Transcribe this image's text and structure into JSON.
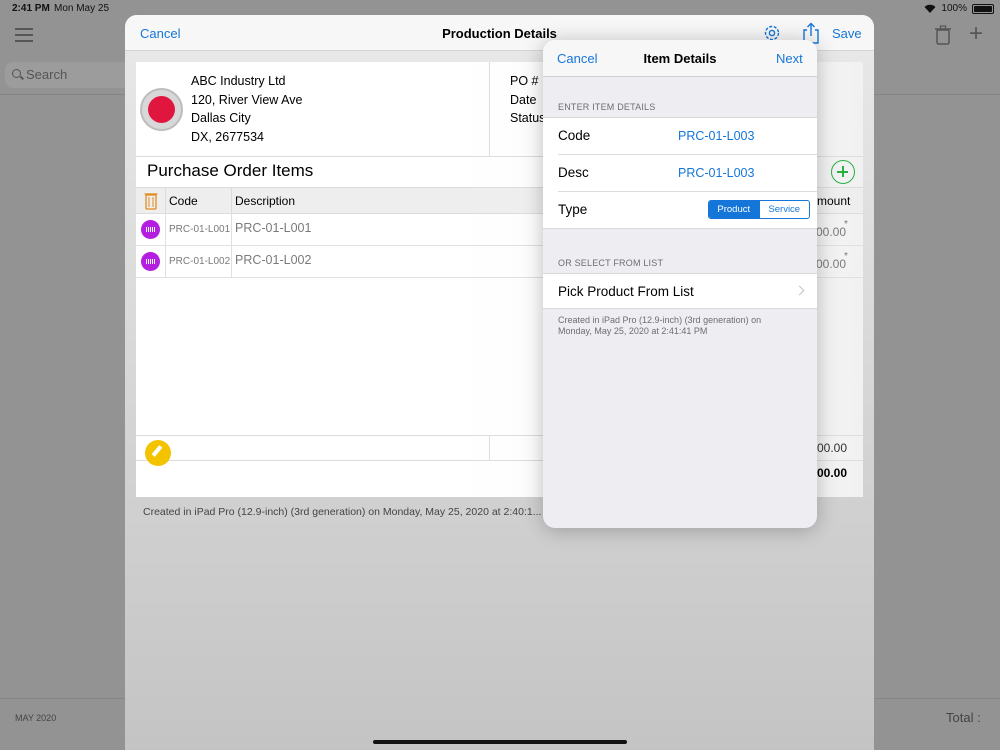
{
  "status_bar": {
    "time": "2:41 PM",
    "date": "Mon May 25",
    "battery": "100%"
  },
  "background": {
    "search_placeholder": "Search",
    "footer_month": "MAY 2020",
    "footer_total_label": "Total :"
  },
  "sheet": {
    "title": "Production Details",
    "cancel_label": "Cancel",
    "save_label": "Save",
    "company": {
      "name": "ABC Industry Ltd",
      "address1": "120, River View Ave",
      "city": "Dallas City",
      "region": "DX, 2677534"
    },
    "po_labels": {
      "po": "PO #",
      "date": "Date",
      "status": "Status"
    },
    "items_title": "Purchase Order Items",
    "columns": {
      "code": "Code",
      "description": "Description",
      "amount": "mount"
    },
    "rows": [
      {
        "code": "PRC-01-L001",
        "description": "PRC-01-L001",
        "amount": "00.00",
        "mark": "*"
      },
      {
        "code": "PRC-01-L002",
        "description": "PRC-01-L002",
        "amount": "00.00",
        "mark": "*"
      }
    ],
    "subtotal": "00.00",
    "total": "00.00",
    "created": "Created in iPad Pro (12.9-inch) (3rd generation) on Monday, May 25, 2020 at 2:40:1..."
  },
  "popover": {
    "title": "Item Details",
    "cancel_label": "Cancel",
    "next_label": "Next",
    "section1": "ENTER ITEM DETAILS",
    "code_label": "Code",
    "code_value": "PRC-01-L003",
    "desc_label": "Desc",
    "desc_value": "PRC-01-L003",
    "type_label": "Type",
    "type_options": [
      "Product",
      "Service"
    ],
    "type_selected": "Product",
    "section2": "OR SELECT FROM LIST",
    "pick_label": "Pick Product From List",
    "footer_line1": "Created in iPad Pro (12.9-inch) (3rd generation) on",
    "footer_line2": "Monday, May 25, 2020 at 2:41:41 PM"
  },
  "colors": {
    "accent": "#1576d9",
    "add_green": "#27b041",
    "item_purple": "#b41ee0",
    "logo_red": "#e0163f",
    "edit_yellow": "#f4c300"
  }
}
